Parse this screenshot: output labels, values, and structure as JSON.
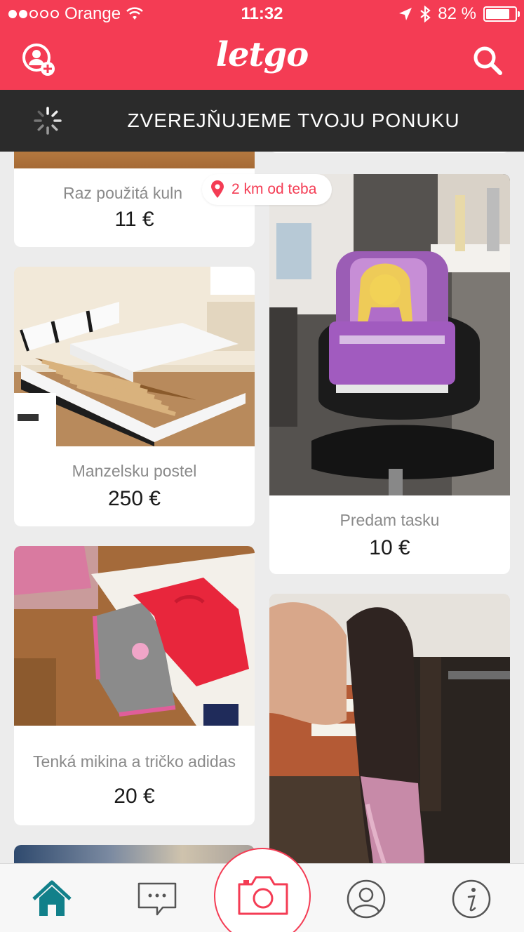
{
  "status_bar": {
    "carrier": "Orange",
    "time": "11:32",
    "battery": "82 %"
  },
  "nav": {
    "logo": "letgo"
  },
  "banner": {
    "text": "ZVEREJŇUJEME TVOJU PONUKU"
  },
  "distance_badge": "2 km od teba",
  "listings": [
    {
      "title": "Raz použitá kuln",
      "price": "11 €"
    },
    {
      "title": "Manzelsku postel",
      "price": "250 €"
    },
    {
      "title": "Tenká mikina a tričko adidas",
      "price": "20 €"
    },
    {
      "title": "Predam tasku",
      "price": "10 €"
    }
  ],
  "tabs": [
    "home-icon",
    "chat-icon",
    "camera-icon",
    "profile-icon",
    "info-icon"
  ],
  "colors": {
    "accent": "#f43c54",
    "active_tab": "#11808a",
    "banner_bg": "#2b2b2b"
  }
}
